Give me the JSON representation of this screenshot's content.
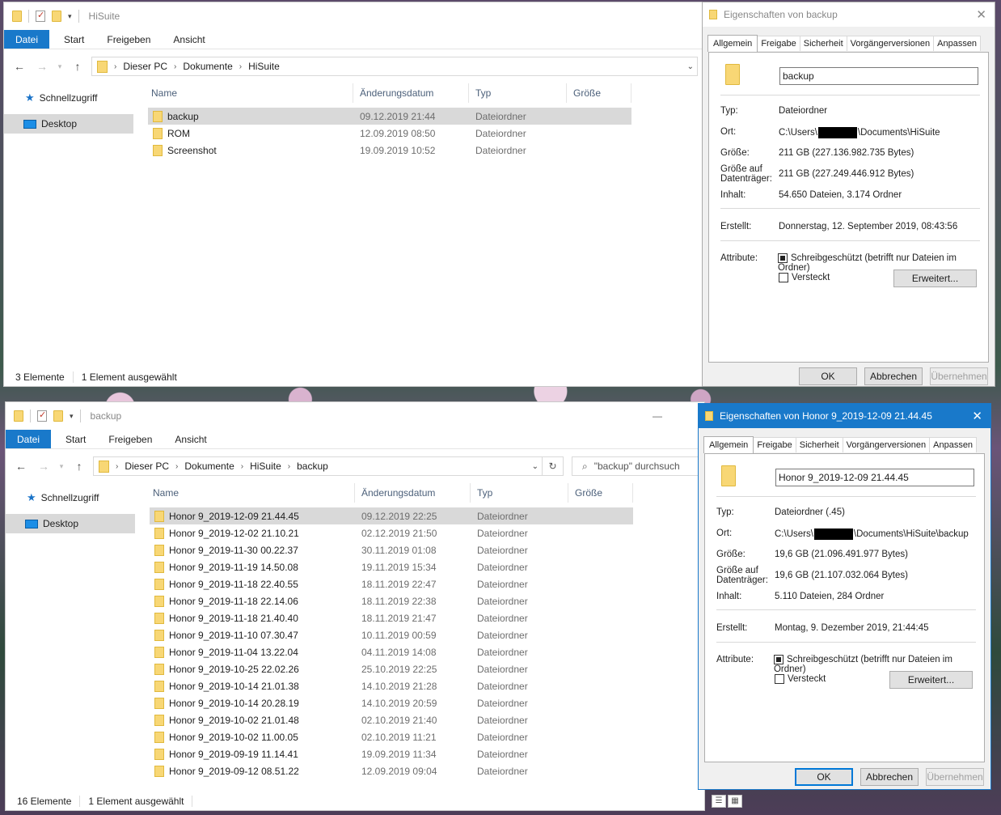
{
  "top_explorer": {
    "title": "HiSuite",
    "ribbon": [
      "Datei",
      "Start",
      "Freigeben",
      "Ansicht"
    ],
    "breadcrumb": [
      "Dieser PC",
      "Dokumente",
      "HiSuite"
    ],
    "nav": [
      "Schnellzugriff",
      "Desktop"
    ],
    "columns": [
      "Name",
      "Änderungsdatum",
      "Typ",
      "Größe"
    ],
    "rows": [
      {
        "name": "backup",
        "date": "09.12.2019 21:44",
        "type": "Dateiordner"
      },
      {
        "name": "ROM",
        "date": "12.09.2019 08:50",
        "type": "Dateiordner"
      },
      {
        "name": "Screenshot",
        "date": "19.09.2019 10:52",
        "type": "Dateiordner"
      }
    ],
    "status_count": "3 Elemente",
    "status_selected": "1 Element ausgewählt"
  },
  "bottom_explorer": {
    "title": "backup",
    "ribbon": [
      "Datei",
      "Start",
      "Freigeben",
      "Ansicht"
    ],
    "breadcrumb": [
      "Dieser PC",
      "Dokumente",
      "HiSuite",
      "backup"
    ],
    "search_placeholder": "\"backup\" durchsuch",
    "nav": [
      "Schnellzugriff",
      "Desktop"
    ],
    "columns": [
      "Name",
      "Änderungsdatum",
      "Typ",
      "Größe"
    ],
    "rows": [
      {
        "name": "Honor 9_2019-12-09 21.44.45",
        "date": "09.12.2019 22:25",
        "type": "Dateiordner"
      },
      {
        "name": "Honor 9_2019-12-02 21.10.21",
        "date": "02.12.2019 21:50",
        "type": "Dateiordner"
      },
      {
        "name": "Honor 9_2019-11-30 00.22.37",
        "date": "30.11.2019 01:08",
        "type": "Dateiordner"
      },
      {
        "name": "Honor 9_2019-11-19 14.50.08",
        "date": "19.11.2019 15:34",
        "type": "Dateiordner"
      },
      {
        "name": "Honor 9_2019-11-18 22.40.55",
        "date": "18.11.2019 22:47",
        "type": "Dateiordner"
      },
      {
        "name": "Honor 9_2019-11-18 22.14.06",
        "date": "18.11.2019 22:38",
        "type": "Dateiordner"
      },
      {
        "name": "Honor 9_2019-11-18 21.40.40",
        "date": "18.11.2019 21:47",
        "type": "Dateiordner"
      },
      {
        "name": "Honor 9_2019-11-10 07.30.47",
        "date": "10.11.2019 00:59",
        "type": "Dateiordner"
      },
      {
        "name": "Honor 9_2019-11-04 13.22.04",
        "date": "04.11.2019 14:08",
        "type": "Dateiordner"
      },
      {
        "name": "Honor 9_2019-10-25 22.02.26",
        "date": "25.10.2019 22:25",
        "type": "Dateiordner"
      },
      {
        "name": "Honor 9_2019-10-14 21.01.38",
        "date": "14.10.2019 21:28",
        "type": "Dateiordner"
      },
      {
        "name": "Honor 9_2019-10-14 20.28.19",
        "date": "14.10.2019 20:59",
        "type": "Dateiordner"
      },
      {
        "name": "Honor 9_2019-10-02 21.01.48",
        "date": "02.10.2019 21:40",
        "type": "Dateiordner"
      },
      {
        "name": "Honor 9_2019-10-02 11.00.05",
        "date": "02.10.2019 11:21",
        "type": "Dateiordner"
      },
      {
        "name": "Honor 9_2019-09-19 11.14.41",
        "date": "19.09.2019 11:34",
        "type": "Dateiordner"
      },
      {
        "name": "Honor 9_2019-09-12 08.51.22",
        "date": "12.09.2019 09:04",
        "type": "Dateiordner"
      }
    ],
    "status_count": "16 Elemente",
    "status_selected": "1 Element ausgewählt"
  },
  "props_top": {
    "title": "Eigenschaften von backup",
    "tabs": [
      "Allgemein",
      "Freigabe",
      "Sicherheit",
      "Vorgängerversionen",
      "Anpassen"
    ],
    "name": "backup",
    "typ_k": "Typ:",
    "typ_v": "Dateiordner",
    "ort_k": "Ort:",
    "ort_v1": "C:\\Users\\",
    "ort_v2": "\\Documents\\HiSuite",
    "groesse_k": "Größe:",
    "groesse_v": "211 GB (227.136.982.735 Bytes)",
    "gad_k1": "Größe auf",
    "gad_k2": "Datenträger:",
    "gad_v": "211 GB (227.249.446.912 Bytes)",
    "inhalt_k": "Inhalt:",
    "inhalt_v": "54.650 Dateien, 3.174 Ordner",
    "erstellt_k": "Erstellt:",
    "erstellt_v": "Donnerstag, 12. September 2019, 08:43:56",
    "attr_k": "Attribute:",
    "readonly": "Schreibgeschützt (betrifft nur Dateien im Ordner)",
    "hidden": "Versteckt",
    "erweitert": "Erweitert...",
    "ok": "OK",
    "abbrechen": "Abbrechen",
    "uebernehmen": "Übernehmen"
  },
  "props_bottom": {
    "title": "Eigenschaften von Honor 9_2019-12-09 21.44.45",
    "tabs": [
      "Allgemein",
      "Freigabe",
      "Sicherheit",
      "Vorgängerversionen",
      "Anpassen"
    ],
    "name": "Honor 9_2019-12-09 21.44.45",
    "typ_k": "Typ:",
    "typ_v": "Dateiordner (.45)",
    "ort_k": "Ort:",
    "ort_v1": "C:\\Users\\",
    "ort_v2": "\\Documents\\HiSuite\\backup",
    "groesse_k": "Größe:",
    "groesse_v": "19,6 GB (21.096.491.977 Bytes)",
    "gad_k1": "Größe auf",
    "gad_k2": "Datenträger:",
    "gad_v": "19,6 GB (21.107.032.064 Bytes)",
    "inhalt_k": "Inhalt:",
    "inhalt_v": "5.110 Dateien, 284 Ordner",
    "erstellt_k": "Erstellt:",
    "erstellt_v": "Montag, 9. Dezember 2019, 21:44:45",
    "attr_k": "Attribute:",
    "readonly": "Schreibgeschützt (betrifft nur Dateien im Ordner)",
    "hidden": "Versteckt",
    "erweitert": "Erweitert...",
    "ok": "OK",
    "abbrechen": "Abbrechen",
    "uebernehmen": "Übernehmen"
  }
}
